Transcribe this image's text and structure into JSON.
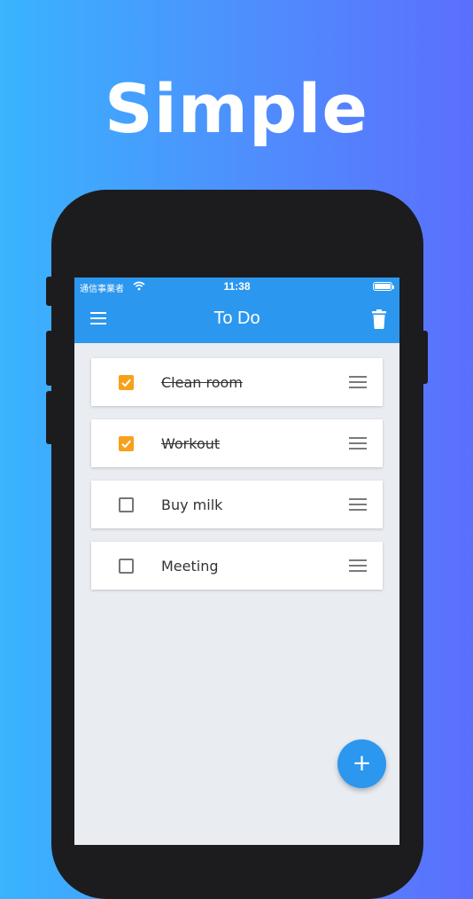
{
  "headline": "Simple",
  "status_bar": {
    "carrier": "通信事業者",
    "time": "11:38"
  },
  "app_bar": {
    "title": "To Do"
  },
  "todos": [
    {
      "label": "Clean room",
      "done": true
    },
    {
      "label": "Workout",
      "done": true
    },
    {
      "label": "Buy milk",
      "done": false
    },
    {
      "label": "Meeting",
      "done": false
    }
  ],
  "fab": {
    "symbol": "+"
  },
  "colors": {
    "accent": "#2b97ef",
    "check": "#f7a11b"
  },
  "icons": [
    "menu-icon",
    "trash-icon",
    "check-icon",
    "drag-handle-icon",
    "add-icon",
    "wifi-icon",
    "battery-icon"
  ]
}
